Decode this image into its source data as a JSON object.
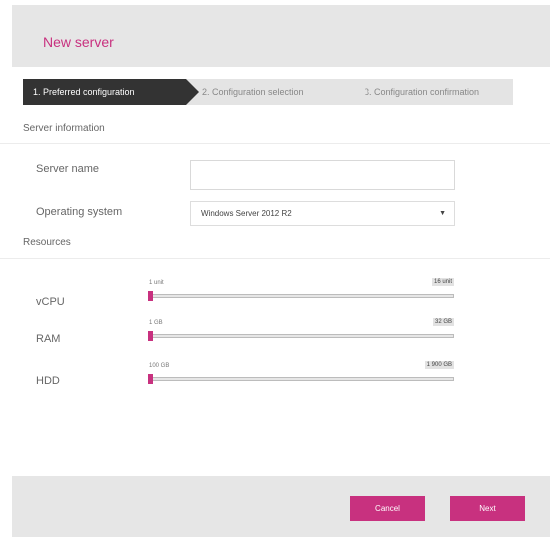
{
  "header": {
    "title": "New server"
  },
  "steps": [
    {
      "label": "1. Preferred configuration",
      "active": true
    },
    {
      "label": "2. Configuration selection",
      "active": false
    },
    {
      "label": "3. Configuration confirmation",
      "active": false
    }
  ],
  "server_info": {
    "section_title": "Server information",
    "name_label": "Server name",
    "name_value": "",
    "os_label": "Operating system",
    "os_value": "Windows Server 2012 R2"
  },
  "resources": {
    "section_title": "Resources",
    "vcpu": {
      "label": "vCPU",
      "min": "1 unit",
      "max": "16 unit",
      "level": 0
    },
    "ram": {
      "label": "RAM",
      "min": "1 GB",
      "max": "32 GB",
      "level": 0
    },
    "hdd": {
      "label": "HDD",
      "min": "100 GB",
      "max": "1 900 GB",
      "level": 0
    }
  },
  "footer": {
    "cancel_label": "Cancel",
    "next_label": "Next"
  },
  "colors": {
    "accent": "#c8317f",
    "active_step": "#333333",
    "panel": "#e6e6e6"
  }
}
